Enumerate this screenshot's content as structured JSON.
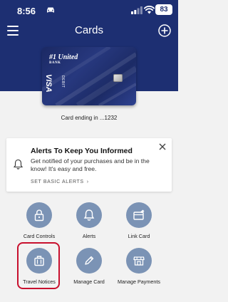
{
  "status_bar": {
    "time": "8:56",
    "battery": "83"
  },
  "header": {
    "title": "Cards"
  },
  "card": {
    "brand": "#1 United",
    "brand_sub": "BANK",
    "network": "VISA",
    "type": "DEBIT",
    "ending_text": "Card ending in ...1232"
  },
  "alert": {
    "title": "Alerts To Keep You Informed",
    "body": "Get notified of your purchases and be in the know! It's easy and free.",
    "link": "SET BASIC ALERTS",
    "link_chevron": "›"
  },
  "actions": [
    {
      "label": "Card Controls",
      "icon": "lock-icon"
    },
    {
      "label": "Alerts",
      "icon": "bell-icon"
    },
    {
      "label": "Link Card",
      "icon": "link-card-icon"
    },
    {
      "label": "Travel Notices",
      "icon": "luggage-icon"
    },
    {
      "label": "Manage Card",
      "icon": "pencil-icon"
    },
    {
      "label": "Manage Payments",
      "icon": "storefront-icon"
    }
  ],
  "colors": {
    "header_bg": "#1d2f72",
    "action_circle": "#7b93b5",
    "highlight": "#c8102e"
  }
}
